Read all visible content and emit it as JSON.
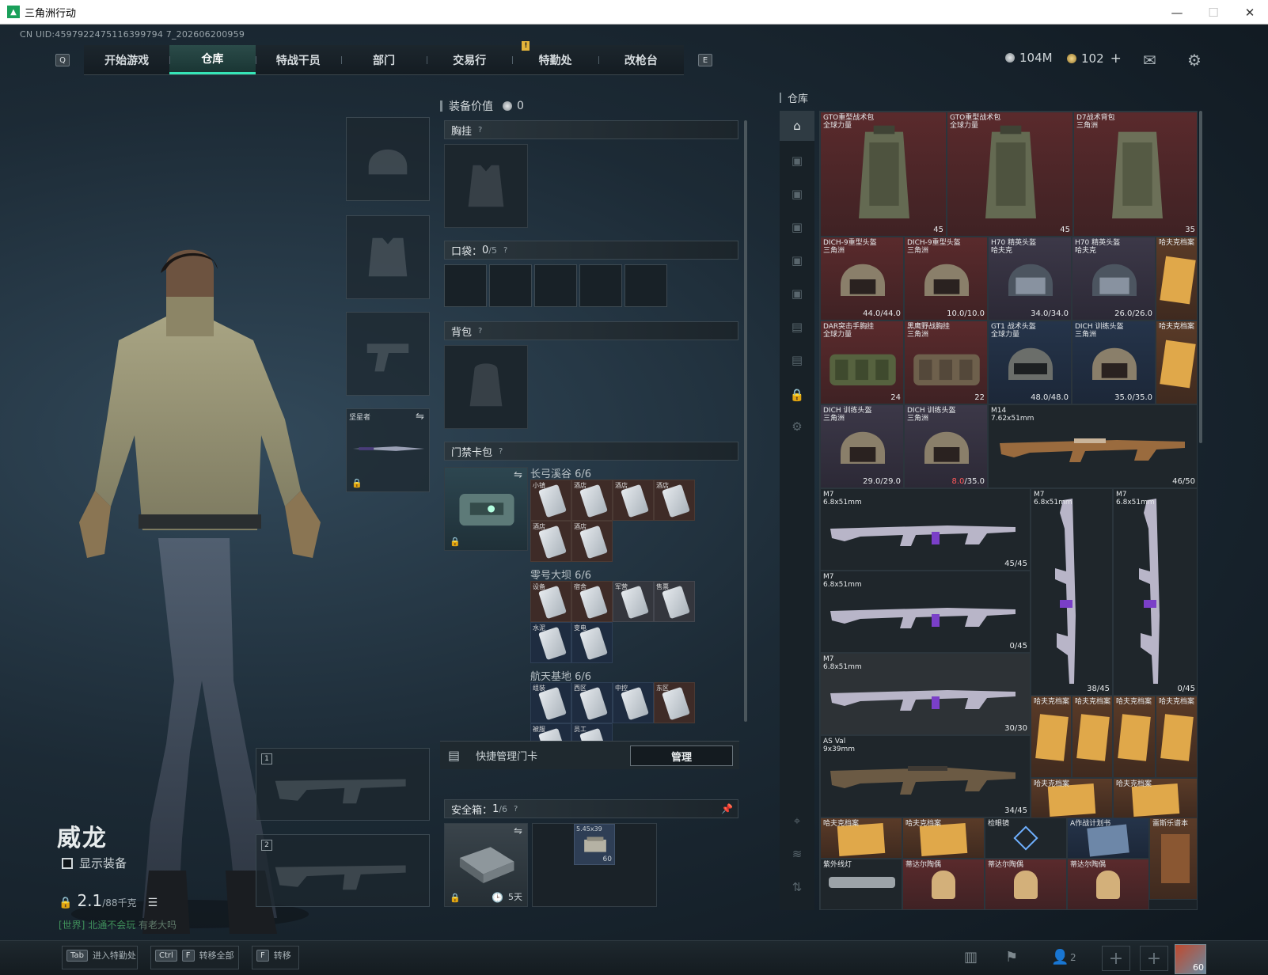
{
  "window": {
    "title": "三角洲行动",
    "uid_text": "CN UID:4597922475116399794 7_202606200959"
  },
  "nav": {
    "left_key": "Q",
    "right_key": "E",
    "tabs": [
      "开始游戏",
      "仓库",
      "特战干员",
      "部门",
      "交易行",
      "特勤处",
      "改枪台"
    ],
    "active_tab": "仓库",
    "badge": "!"
  },
  "currency": {
    "silver": "104M",
    "gold": "102",
    "gold_plus": "+"
  },
  "character": {
    "name": "威龙",
    "show_equip_label": "显示装备",
    "weight_value": "2.1",
    "weight_unit": "/88千克",
    "chat_channel": "[世界]",
    "chat_user": "北通不会玩",
    "chat_msg": "有老大吗"
  },
  "loadout": {
    "melee_label": "坚星者",
    "slot1": "1",
    "slot2": "2"
  },
  "equipment": {
    "value_label": "装备价值",
    "value": "0",
    "chest_label": "胸挂",
    "pocket_label": "口袋：",
    "pocket_count": "0",
    "pocket_max": "/5",
    "backpack_label": "背包",
    "keycard_label": "门禁卡包",
    "help": "?",
    "areas": [
      {
        "name": "长弓溪谷",
        "count": "6/6",
        "cards": [
          "小镇",
          "酒店",
          "酒店",
          "酒店",
          "酒店",
          "酒店"
        ]
      },
      {
        "name": "零号大坝",
        "count": "6/6",
        "cards": [
          "设备",
          "宿舍",
          "军营",
          "售票",
          "水泥",
          "变电"
        ]
      },
      {
        "name": "航天基地",
        "count": "6/6",
        "cards": [
          "组装",
          "西区",
          "中控",
          "东区",
          "被服",
          "员工"
        ]
      }
    ],
    "quick_manage_label": "快捷管理门卡",
    "manage_btn": "管理",
    "safe_label": "安全箱：",
    "safe_count": "1",
    "safe_max": "/6",
    "safe_time": "5天",
    "ammo_name": "5.45x39",
    "ammo_count": "60"
  },
  "warehouse": {
    "title": "仓库",
    "items": [
      {
        "name": "GTO重型战术包",
        "sub": "全球力量",
        "val": "45"
      },
      {
        "name": "GTO重型战术包",
        "sub": "全球力量",
        "val": "45"
      },
      {
        "name": "D7战术背包",
        "sub": "三角洲",
        "val": "35"
      },
      {
        "name": "DICH-9重型头盔",
        "sub": "三角洲",
        "val": "44.0/44.0"
      },
      {
        "name": "DICH-9重型头盔",
        "sub": "三角洲",
        "val": "10.0/10.0"
      },
      {
        "name": "H70 精英头盔",
        "sub": "哈夫克",
        "val": "34.0/34.0"
      },
      {
        "name": "H70 精英头盔",
        "sub": "哈夫克",
        "val": "26.0/26.0"
      },
      {
        "name": "哈夫克档案",
        "sub": "",
        "val": ""
      },
      {
        "name": "DAR突击手胸挂",
        "sub": "全球力量",
        "val": "24"
      },
      {
        "name": "黑鹰野战胸挂",
        "sub": "三角洲",
        "val": "22"
      },
      {
        "name": "GT1 战术头盔",
        "sub": "全球力量",
        "val": "48.0/48.0"
      },
      {
        "name": "DICH 训练头盔",
        "sub": "三角洲",
        "val": "35.0/35.0"
      },
      {
        "name": "哈夫克档案",
        "sub": "",
        "val": ""
      },
      {
        "name": "DICH 训练头盔",
        "sub": "三角洲",
        "val": "29.0/29.0"
      },
      {
        "name": "DICH 训练头盔",
        "sub": "三角洲",
        "val": "8.0",
        "val2": "/35.0"
      },
      {
        "name": "M14",
        "sub": "7.62x51mm",
        "val": "46/50"
      },
      {
        "name": "M7",
        "sub": "6.8x51mm",
        "val": "45/45"
      },
      {
        "name": "M7",
        "sub": "6.8x51mm",
        "val": "38/45"
      },
      {
        "name": "M7",
        "sub": "6.8x51mm",
        "val": "0/45"
      },
      {
        "name": "M7",
        "sub": "6.8x51mm",
        "val": "0/45"
      },
      {
        "name": "M7",
        "sub": "6.8x51mm",
        "val": "30/30"
      },
      {
        "name": "哈夫克档案",
        "sub": "",
        "val": ""
      },
      {
        "name": "哈夫克档案",
        "sub": "",
        "val": ""
      },
      {
        "name": "哈夫克档案",
        "sub": "",
        "val": ""
      },
      {
        "name": "哈夫克档案",
        "sub": "",
        "val": ""
      },
      {
        "name": "AS Val",
        "sub": "9x39mm",
        "val": "34/45"
      },
      {
        "name": "哈夫克档案",
        "sub": "",
        "val": ""
      },
      {
        "name": "哈夫克档案",
        "sub": "",
        "val": ""
      },
      {
        "name": "哈夫克档案",
        "sub": "",
        "val": ""
      },
      {
        "name": "哈夫克档案",
        "sub": "",
        "val": ""
      },
      {
        "name": "检眼镜",
        "sub": "",
        "val": ""
      },
      {
        "name": "A作战计划书",
        "sub": "",
        "val": ""
      },
      {
        "name": "雷斯乐谱本",
        "sub": "",
        "val": ""
      },
      {
        "name": "紫外线灯",
        "sub": "",
        "val": ""
      },
      {
        "name": "蒂达尔陶偶",
        "sub": "",
        "val": ""
      },
      {
        "name": "蒂达尔陶偶",
        "sub": "",
        "val": ""
      },
      {
        "name": "蒂达尔陶偶",
        "sub": "",
        "val": ""
      }
    ]
  },
  "bottom": {
    "hint1_key": "Tab",
    "hint1": "进入特勤处",
    "hint2_key1": "Ctrl",
    "hint2_key2": "F",
    "hint2": "转移全部",
    "hint3_key": "F",
    "hint3": "转移",
    "friends_count": "2",
    "level": "60"
  }
}
